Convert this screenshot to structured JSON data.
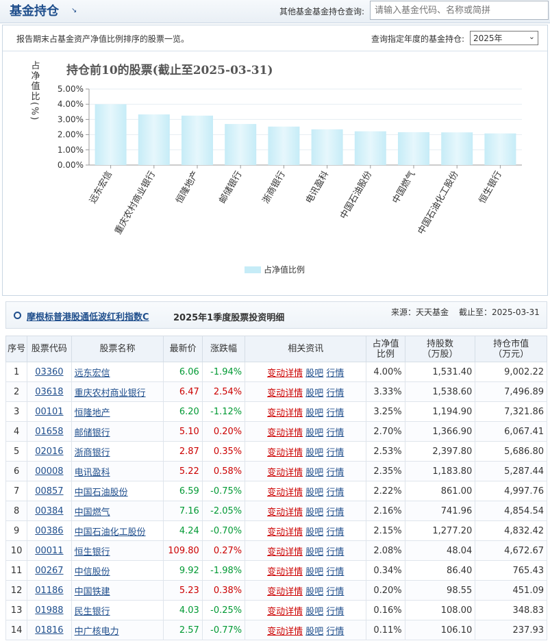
{
  "header": {
    "title": "基金持仓",
    "other_fund_label": "其他基金基金持仓查询:",
    "search_placeholder": "请输入基金代码、名称或简拼"
  },
  "filter": {
    "description": "报告期末占基金资产净值比例排序的股票一览。",
    "year_label": "查询指定年度的基金持仓:",
    "year_selected": "2025年"
  },
  "colors": {
    "brand": "#1f4e8c",
    "bar": "#c6ecf7",
    "up": "#cc0000",
    "down": "#009933"
  },
  "chart_data": {
    "type": "bar",
    "title": "持仓前10的股票(截止至2025-03-31)",
    "ylabel": "占净值比(%)",
    "ylim": [
      0,
      5
    ],
    "ytick_labels": [
      "0.00%",
      "1.00%",
      "2.00%",
      "3.00%",
      "4.00%",
      "5.00%"
    ],
    "categories": [
      "远东宏信",
      "重庆农村商业银行",
      "恒隆地产",
      "邮储银行",
      "浙商银行",
      "电讯盈科",
      "中国石油股份",
      "中国燃气",
      "中国石油化工股份",
      "恒生银行"
    ],
    "series": [
      {
        "name": "占净值比例",
        "values": [
          4.0,
          3.33,
          3.25,
          2.7,
          2.53,
          2.35,
          2.22,
          2.16,
          2.15,
          2.08
        ]
      }
    ],
    "legend": "bottom-center",
    "grid": true
  },
  "detail": {
    "fund_name": "摩根标普港股通低波红利指数C",
    "period": "2025年1季度股票投资明细",
    "source": "来源：天天基金",
    "as_of": "截止至：2025-03-31"
  },
  "table": {
    "headers": {
      "no": "序号",
      "code": "股票代码",
      "name": "股票名称",
      "price": "最新价",
      "change": "涨跌幅",
      "info": "相关资讯",
      "ratio_1": "占净值",
      "ratio_2": "比例",
      "shares_1": "持股数",
      "shares_2": "（万股）",
      "value_1": "持仓市值",
      "value_2": "（万元）"
    },
    "link_labels": {
      "detail": "变动详情",
      "bar": "股吧",
      "quote": "行情"
    },
    "rows": [
      {
        "no": "1",
        "code": "03360",
        "name": "远东宏信",
        "price": "6.06",
        "change": "-1.94%",
        "ratio": "4.00%",
        "shares": "1,531.40",
        "value": "9,002.22"
      },
      {
        "no": "2",
        "code": "03618",
        "name": "重庆农村商业银行",
        "price": "6.47",
        "change": "2.54%",
        "ratio": "3.33%",
        "shares": "1,538.60",
        "value": "7,496.89"
      },
      {
        "no": "3",
        "code": "00101",
        "name": "恒隆地产",
        "price": "6.20",
        "change": "-1.12%",
        "ratio": "3.25%",
        "shares": "1,194.90",
        "value": "7,321.86"
      },
      {
        "no": "4",
        "code": "01658",
        "name": "邮储银行",
        "price": "5.10",
        "change": "0.20%",
        "ratio": "2.70%",
        "shares": "1,366.90",
        "value": "6,067.41"
      },
      {
        "no": "5",
        "code": "02016",
        "name": "浙商银行",
        "price": "2.87",
        "change": "0.35%",
        "ratio": "2.53%",
        "shares": "2,397.80",
        "value": "5,686.80"
      },
      {
        "no": "6",
        "code": "00008",
        "name": "电讯盈科",
        "price": "5.22",
        "change": "0.58%",
        "ratio": "2.35%",
        "shares": "1,183.80",
        "value": "5,287.44"
      },
      {
        "no": "7",
        "code": "00857",
        "name": "中国石油股份",
        "price": "6.59",
        "change": "-0.75%",
        "ratio": "2.22%",
        "shares": "861.00",
        "value": "4,997.76"
      },
      {
        "no": "8",
        "code": "00384",
        "name": "中国燃气",
        "price": "7.16",
        "change": "-2.05%",
        "ratio": "2.16%",
        "shares": "741.96",
        "value": "4,854.54"
      },
      {
        "no": "9",
        "code": "00386",
        "name": "中国石油化工股份",
        "price": "4.24",
        "change": "-0.70%",
        "ratio": "2.15%",
        "shares": "1,277.20",
        "value": "4,832.42"
      },
      {
        "no": "10",
        "code": "00011",
        "name": "恒生银行",
        "price": "109.80",
        "change": "0.27%",
        "ratio": "2.08%",
        "shares": "48.04",
        "value": "4,672.67"
      },
      {
        "no": "11",
        "code": "00267",
        "name": "中信股份",
        "price": "9.92",
        "change": "-1.98%",
        "ratio": "0.34%",
        "shares": "86.40",
        "value": "765.43"
      },
      {
        "no": "12",
        "code": "01186",
        "name": "中国铁建",
        "price": "5.23",
        "change": "0.38%",
        "ratio": "0.20%",
        "shares": "98.55",
        "value": "451.09"
      },
      {
        "no": "13",
        "code": "01988",
        "name": "民生银行",
        "price": "4.03",
        "change": "-0.25%",
        "ratio": "0.16%",
        "shares": "108.00",
        "value": "348.83"
      },
      {
        "no": "14",
        "code": "01816",
        "name": "中广核电力",
        "price": "2.57",
        "change": "-0.77%",
        "ratio": "0.11%",
        "shares": "106.10",
        "value": "237.93"
      }
    ]
  }
}
